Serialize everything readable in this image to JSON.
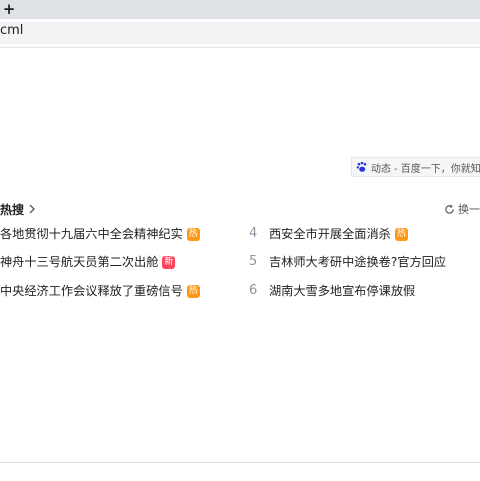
{
  "browser": {
    "new_tab_glyph": "+",
    "address": "cml"
  },
  "news_banner": {
    "text": "动态 - 百度一下，你就知"
  },
  "hot_search": {
    "title": "热搜",
    "refresh_label": "换一",
    "left_items": [
      {
        "text": "各地贯彻十九届六中全会精神纪实",
        "badge": "热"
      },
      {
        "text": "神舟十三号航天员第二次出舱",
        "badge": "新"
      },
      {
        "text": "中央经济工作会议释放了重磅信号",
        "badge": "热"
      }
    ],
    "right_items": [
      {
        "rank": "4",
        "text": "西安全市开展全面消杀",
        "badge": "热"
      },
      {
        "rank": "5",
        "text": "吉林师大考研中途换卷?官方回应",
        "badge": ""
      },
      {
        "rank": "6",
        "text": "湖南大雪多地宣布停课放假",
        "badge": ""
      }
    ]
  },
  "colors": {
    "hot_badge": "#ff9812",
    "new_badge": "#ff455b",
    "rank": "#9195a3"
  }
}
